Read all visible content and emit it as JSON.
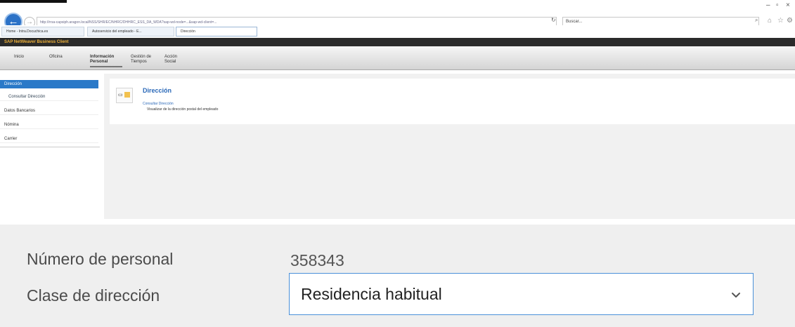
{
  "browser": {
    "address_text": "http://rrsa-capsiph.aragon.local/NSS/SHR/EC/NHRC/DHHRC_ESS_DA_WDA?sap-wd-node=...&sap-wd-client=...",
    "search_placeholder": "Buscar...",
    "tabs": [
      {
        "label": "Home - Intra.Docuchica.es"
      },
      {
        "label": "Autoservicio del empleado - E..."
      },
      {
        "label": "Dirección"
      }
    ]
  },
  "sap": {
    "title": "SAP NetWeaver Business Client",
    "nav": [
      {
        "label": "Inicio"
      },
      {
        "label": "Oficina"
      },
      {
        "label": "Información Personal"
      },
      {
        "label": "Gestión de Tiempos"
      },
      {
        "label": "Acción Social"
      }
    ]
  },
  "sidebar": {
    "items": [
      {
        "label": "Dirección"
      },
      {
        "label": "Consultar Dirección"
      },
      {
        "label": "Datos Bancarios"
      },
      {
        "label": "Nómina"
      },
      {
        "label": "Carrier"
      }
    ]
  },
  "panel": {
    "title": "Dirección",
    "link": "Consultar Dirección",
    "description": "Visualizar de la dirección postal del empleado"
  },
  "form": {
    "personal_number_label": "Número de personal",
    "personal_number_value": "358343",
    "address_class_label": "Clase de dirección",
    "address_class_value": "Residencia habitual"
  },
  "colors": {
    "accent": "#2a79c8",
    "sap_title": "#f0b23a",
    "select_border": "#4a90d9"
  }
}
